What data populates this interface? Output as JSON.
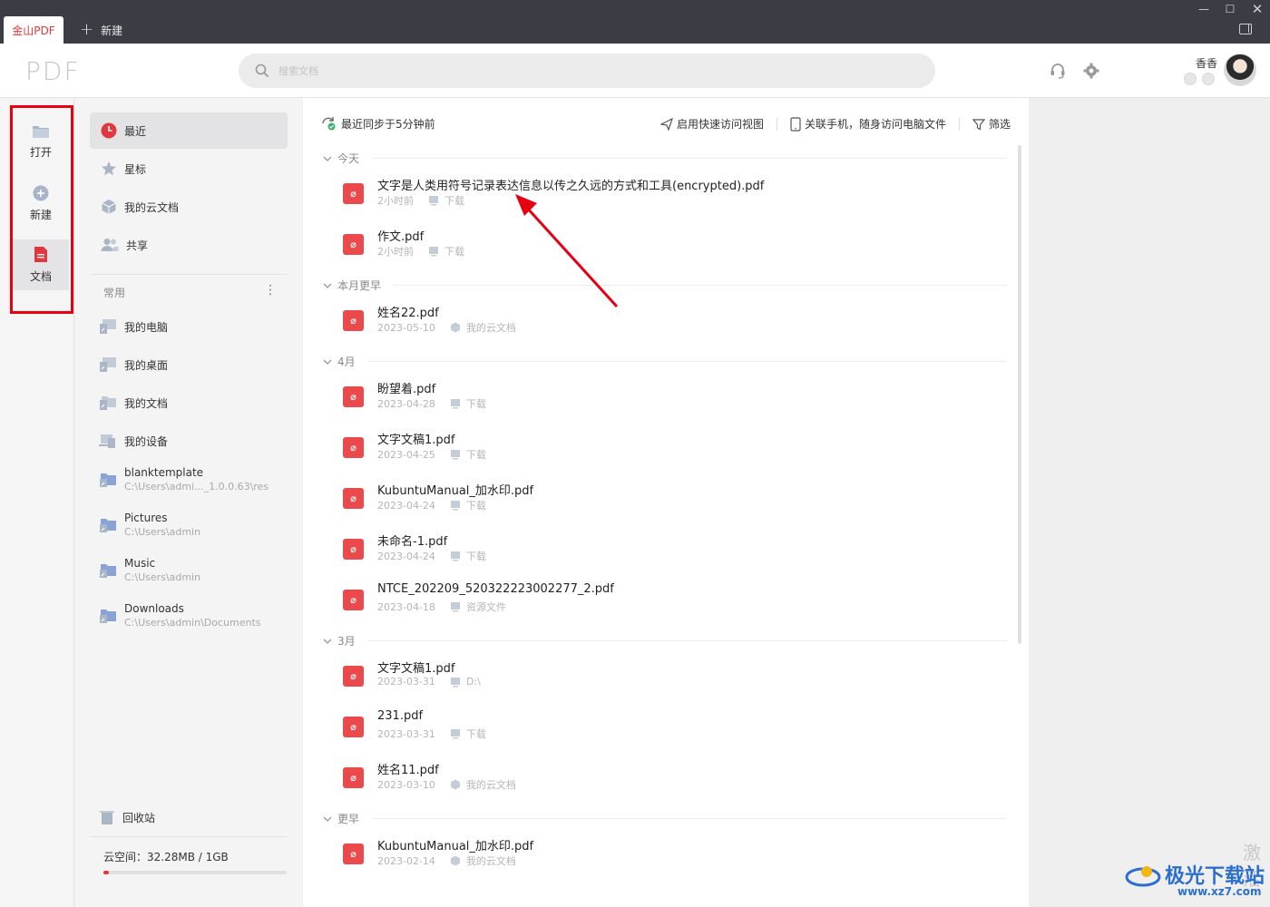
{
  "titlebar": {
    "active_tab": "金山PDF",
    "new_tab_label": "新建",
    "window_controls": [
      "minimize-icon",
      "maximize-icon",
      "close-icon"
    ]
  },
  "header": {
    "logo": "PDF",
    "search_placeholder": "搜索文档",
    "user_name": "香香",
    "icons": [
      "headset-icon",
      "gear-icon"
    ]
  },
  "rail": {
    "open": "打开",
    "new": "新建",
    "documents": "文档"
  },
  "side": {
    "nav": [
      {
        "label": "最近",
        "icon": "clock-icon"
      },
      {
        "label": "星标",
        "icon": "star-icon"
      },
      {
        "label": "我的云文档",
        "icon": "cloud-doc-icon"
      },
      {
        "label": "共享",
        "icon": "users-icon"
      }
    ],
    "section_title": "常用",
    "places": [
      {
        "label": "我的电脑"
      },
      {
        "label": "我的桌面"
      },
      {
        "label": "我的文档"
      },
      {
        "label": "我的设备"
      }
    ],
    "folders": [
      {
        "name": "blanktemplate",
        "path": "C:\\Users\\admi..._1.0.0.63\\res"
      },
      {
        "name": "Pictures",
        "path": "C:\\Users\\admin"
      },
      {
        "name": "Music",
        "path": "C:\\Users\\admin"
      },
      {
        "name": "Downloads",
        "path": "C:\\Users\\admin\\Documents"
      }
    ],
    "recycle": "回收站",
    "storage": "云空间：32.28MB / 1GB",
    "storage_used_fraction": 0.032
  },
  "main": {
    "sync_status": "最近同步于5分钟前",
    "actions": {
      "quick_view": "启用快速访问视图",
      "phone": "关联手机，随身访问电脑文件",
      "filter": "筛选"
    },
    "groups": [
      {
        "title": "今天",
        "files": [
          {
            "name": "文字是人类用符号记录表达信息以传之久远的方式和工具(encrypted).pdf",
            "date": "2小时前",
            "location": "下载",
            "loc_icon": "download-icon"
          },
          {
            "name": "作文.pdf",
            "date": "2小时前",
            "location": "下载",
            "loc_icon": "download-icon"
          }
        ]
      },
      {
        "title": "本月更早",
        "files": [
          {
            "name": "姓名22.pdf",
            "date": "2023-05-10",
            "location": "我的云文档",
            "loc_icon": "cloud-doc-icon"
          }
        ]
      },
      {
        "title": "4月",
        "files": [
          {
            "name": "盼望着.pdf",
            "date": "2023-04-28",
            "location": "下载",
            "loc_icon": "download-icon"
          },
          {
            "name": "文字文稿1.pdf",
            "date": "2023-04-25",
            "location": "下载",
            "loc_icon": "download-icon"
          },
          {
            "name": "KubuntuManual_加水印.pdf",
            "date": "2023-04-24",
            "location": "下载",
            "loc_icon": "download-icon"
          },
          {
            "name": "未命名-1.pdf",
            "date": "2023-04-24",
            "location": "下载",
            "loc_icon": "download-icon"
          },
          {
            "name": "NTCE_202209_520322223002277_2.pdf",
            "date": "2023-04-18",
            "location": "资源文件",
            "loc_icon": "download-icon"
          }
        ]
      },
      {
        "title": "3月",
        "files": [
          {
            "name": "文字文稿1.pdf",
            "date": "2023-03-31",
            "location": "D:\\",
            "loc_icon": "download-icon"
          },
          {
            "name": "231.pdf",
            "date": "2023-03-31",
            "location": "下载",
            "loc_icon": "download-icon"
          },
          {
            "name": "姓名11.pdf",
            "date": "2023-03-10",
            "location": "我的云文档",
            "loc_icon": "cloud-doc-icon"
          }
        ]
      },
      {
        "title": "更早",
        "files": [
          {
            "name": "KubuntuManual_加水印.pdf",
            "date": "2023-02-14",
            "location": "我的云文档",
            "loc_icon": "cloud-doc-icon"
          }
        ]
      }
    ]
  },
  "watermark": {
    "partial_text": "激活",
    "brand": "极光下载站",
    "url": "www.xz7.com"
  },
  "colors": {
    "accent": "#e0383e",
    "pdf_icon": "#ea4a4c",
    "annotation": "#e60012"
  }
}
